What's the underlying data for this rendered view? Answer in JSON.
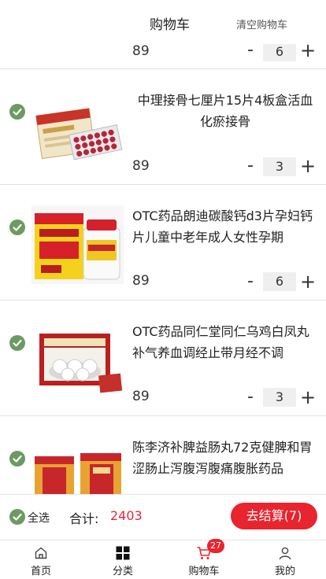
{
  "header": {
    "title": "购物车",
    "clear_label": "清空购物车"
  },
  "items": [
    {
      "name": "",
      "price": "89",
      "qty": "6"
    },
    {
      "name": "中理接骨七厘片15片4板盒活血化瘀接骨",
      "price": "89",
      "qty": "3"
    },
    {
      "name": "OTC药品朗迪碳酸钙d3片孕妇钙片儿童中老年成人女性孕期",
      "price": "89",
      "qty": "6"
    },
    {
      "name": "OTC药品同仁堂同仁乌鸡白凤丸补气养血调经止带月经不调",
      "price": "89",
      "qty": "3"
    },
    {
      "name": "陈李济补脾益肠丸72克健脾和胃涩肠止泻腹泻腹痛腹胀药品",
      "price": "",
      "qty": ""
    }
  ],
  "controls": {
    "minus": "-",
    "plus": "+"
  },
  "footer": {
    "select_all": "全选",
    "total_label": "合计:",
    "total_value": "2403",
    "checkout_label": "去结算(7)"
  },
  "tabbar": [
    {
      "label": "首页",
      "icon": "home-icon"
    },
    {
      "label": "分类",
      "icon": "grid-icon"
    },
    {
      "label": "购物车",
      "icon": "cart-icon",
      "badge": "27"
    },
    {
      "label": "我的",
      "icon": "user-icon"
    }
  ],
  "colors": {
    "accent": "#e8242f",
    "check": "#6b9a62",
    "total": "#e4283b"
  }
}
